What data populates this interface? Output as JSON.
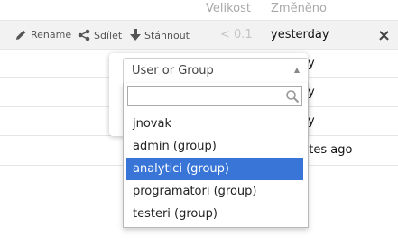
{
  "table": {
    "columns": {
      "size": "Velikost",
      "modified": "Změněno"
    },
    "selected_row": {
      "actions": {
        "rename": "Rename",
        "share": "Sdílet",
        "download": "Stáhnout"
      },
      "size": "< 0.1",
      "modified": "yesterday",
      "close": "×"
    },
    "rows_partial_text": [
      "y",
      "y",
      "y",
      "utes ago"
    ]
  },
  "share_popover": {
    "select": {
      "label": "User or Group",
      "arrow": "▲"
    },
    "search": {
      "value": "",
      "placeholder": ""
    },
    "options": [
      {
        "label": "jnovak",
        "highlighted": false
      },
      {
        "label": "admin (group)",
        "highlighted": false
      },
      {
        "label": "analytici (group)",
        "highlighted": true
      },
      {
        "label": "programatori (group)",
        "highlighted": false
      },
      {
        "label": "testeri (group)",
        "highlighted": false
      }
    ]
  },
  "colors": {
    "highlight": "#3875d7",
    "row_selected_bg": "#f2f2f2",
    "header_text": "#a9a9a9"
  },
  "icons": [
    "pencil-icon",
    "share-icon",
    "download-icon",
    "close-icon",
    "search-icon",
    "triangle-up-icon"
  ]
}
